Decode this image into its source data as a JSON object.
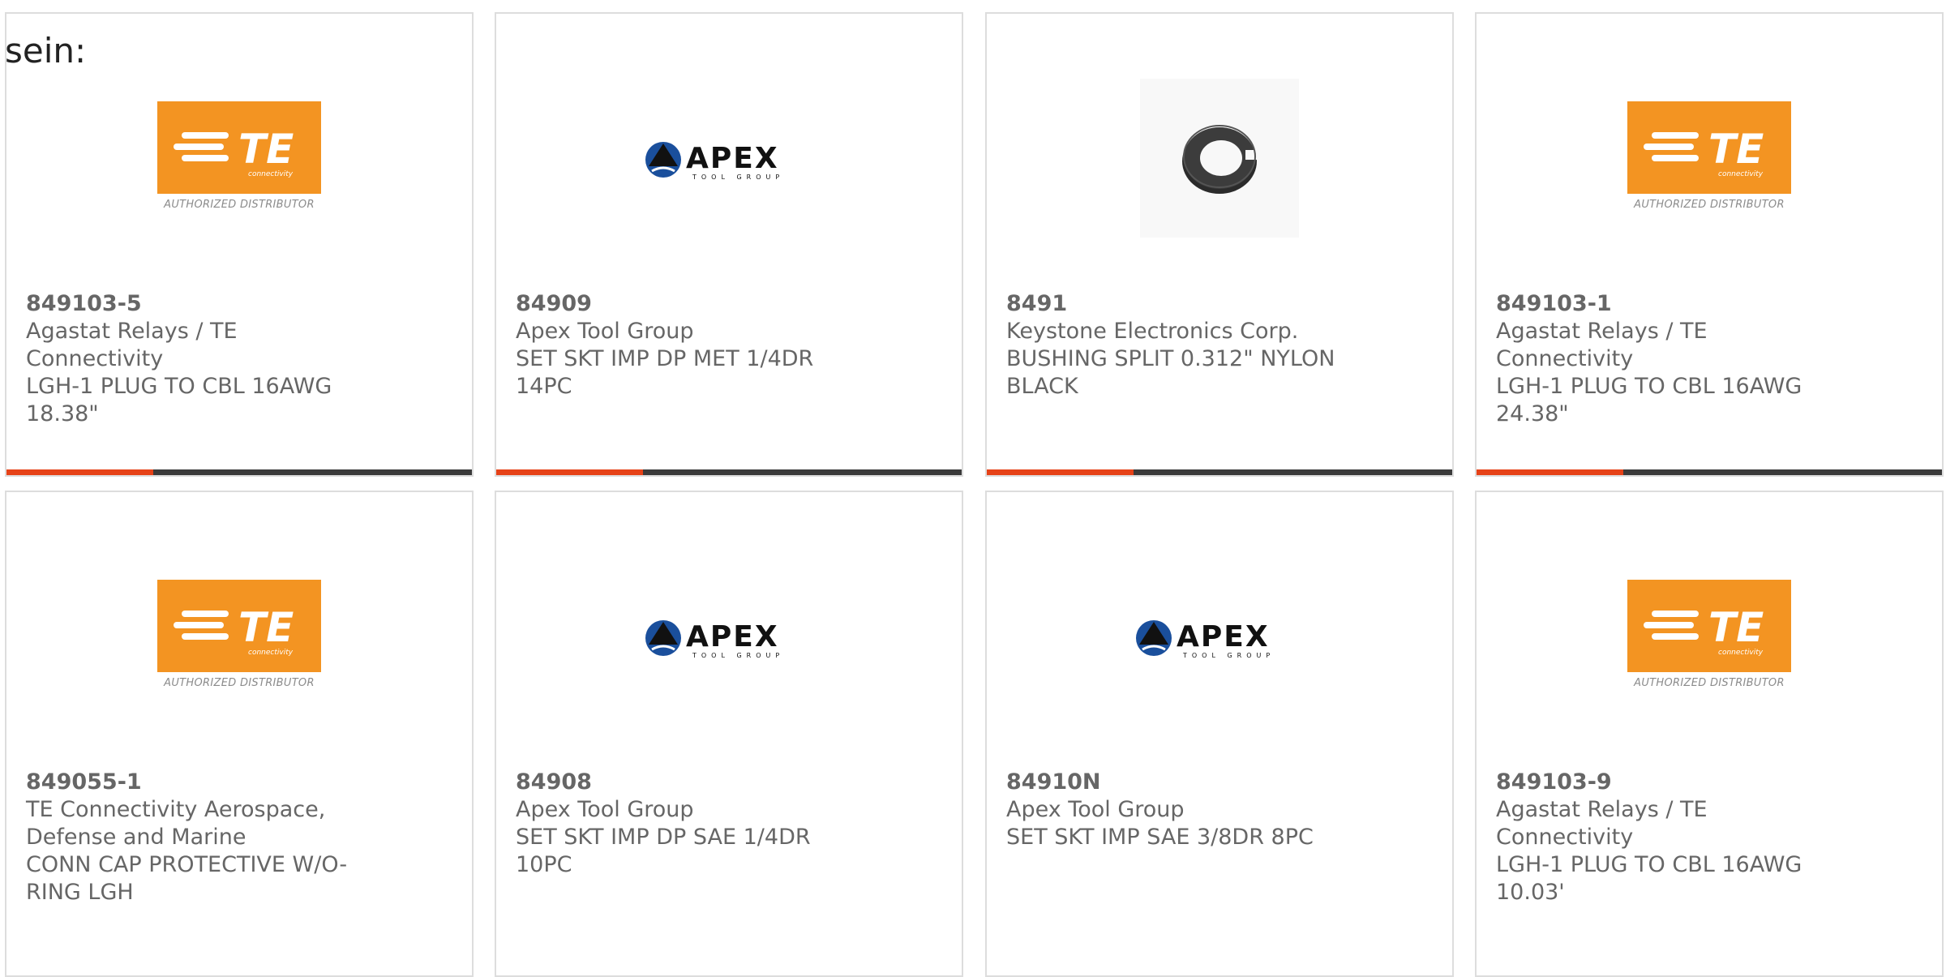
{
  "page": {
    "lead_text": "sein:"
  },
  "accent_color": "#e64218",
  "bar_color": "#3b3b3b",
  "products": [
    {
      "part_number": "849103-5",
      "manufacturer": "Agastat Relays / TE Connectivity",
      "description": [
        "LGH-1 PLUG TO CBL 16AWG",
        "18.38\""
      ],
      "image": "te-connectivity-logo",
      "image_caption": "AUTHORIZED DISTRIBUTOR"
    },
    {
      "part_number": "84909",
      "manufacturer": "Apex Tool Group",
      "description": [
        "SET SKT IMP DP MET 1/4DR",
        "14PC"
      ],
      "image": "apex-tool-group-logo",
      "image_text": "APEX",
      "image_subtext": "TOOL GROUP"
    },
    {
      "part_number": "8491",
      "manufacturer": "Keystone Electronics Corp.",
      "description": [
        "BUSHING SPLIT 0.312\" NYLON",
        "BLACK"
      ],
      "image": "split-bushing-photo"
    },
    {
      "part_number": "849103-1",
      "manufacturer": "Agastat Relays / TE Connectivity",
      "description": [
        "LGH-1 PLUG TO CBL 16AWG",
        "24.38\""
      ],
      "image": "te-connectivity-logo",
      "image_caption": "AUTHORIZED DISTRIBUTOR"
    },
    {
      "part_number": "849055-1",
      "manufacturer": "TE Connectivity Aerospace,\nDefense and Marine",
      "description": [
        "CONN CAP PROTECTIVE W/O-",
        "RING LGH"
      ],
      "image": "te-connectivity-logo",
      "image_caption": "AUTHORIZED DISTRIBUTOR"
    },
    {
      "part_number": "84908",
      "manufacturer": "Apex Tool Group",
      "description": [
        "SET SKT IMP DP SAE 1/4DR 10PC"
      ],
      "image": "apex-tool-group-logo",
      "image_text": "APEX",
      "image_subtext": "TOOL GROUP"
    },
    {
      "part_number": "84910N",
      "manufacturer": "Apex Tool Group",
      "description": [
        "SET SKT IMP SAE 3/8DR 8PC"
      ],
      "image": "apex-tool-group-logo",
      "image_text": "APEX",
      "image_subtext": "TOOL GROUP"
    },
    {
      "part_number": "849103-9",
      "manufacturer": "Agastat Relays / TE Connectivity",
      "description": [
        "LGH-1 PLUG TO CBL 16AWG",
        "10.03'"
      ],
      "image": "te-connectivity-logo",
      "image_caption": "AUTHORIZED DISTRIBUTOR"
    }
  ]
}
